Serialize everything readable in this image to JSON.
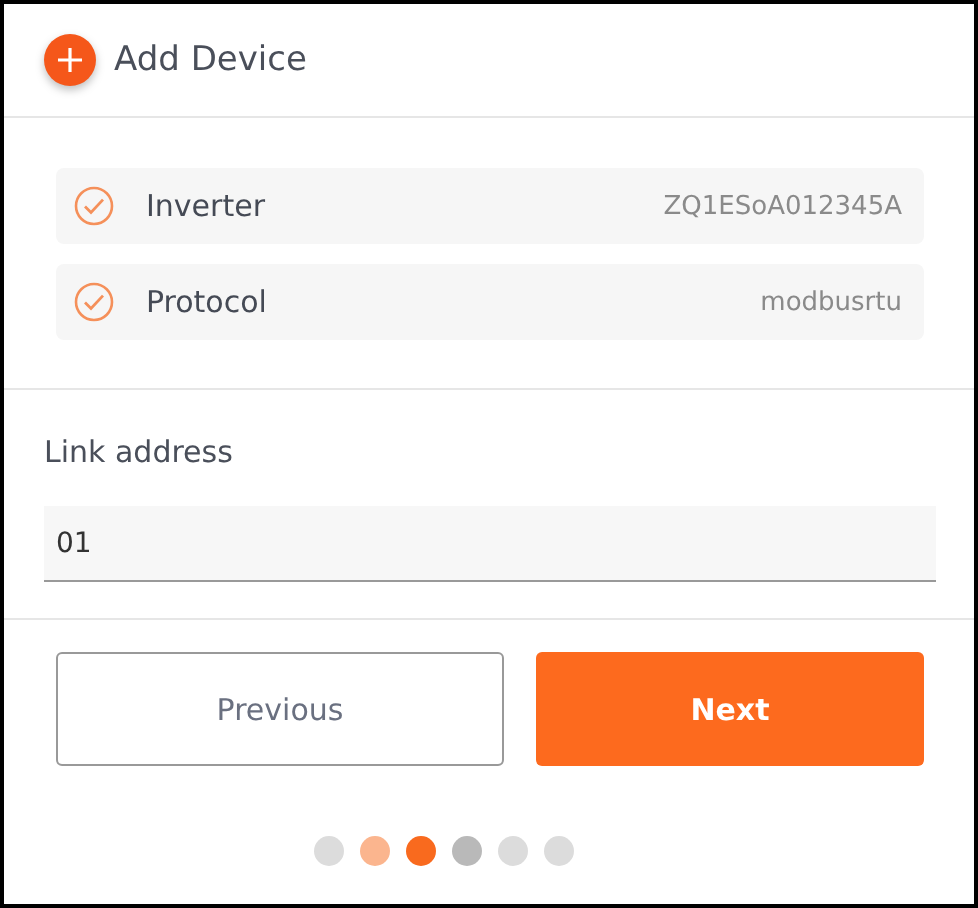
{
  "header": {
    "title": "Add Device"
  },
  "summary": [
    {
      "label": "Inverter",
      "value": "ZQ1ESoA012345A",
      "checked": true
    },
    {
      "label": "Protocol",
      "value": "modbusrtu",
      "checked": true
    }
  ],
  "field": {
    "label": "Link address",
    "value": "01"
  },
  "buttons": {
    "previous": "Previous",
    "next": "Next"
  },
  "steps": [
    {
      "color": "#dcdcdc"
    },
    {
      "color": "#fbb58e"
    },
    {
      "color": "#f96a1e"
    },
    {
      "color": "#b9b9b9"
    },
    {
      "color": "#dcdcdc"
    },
    {
      "color": "#dcdcdc"
    }
  ]
}
